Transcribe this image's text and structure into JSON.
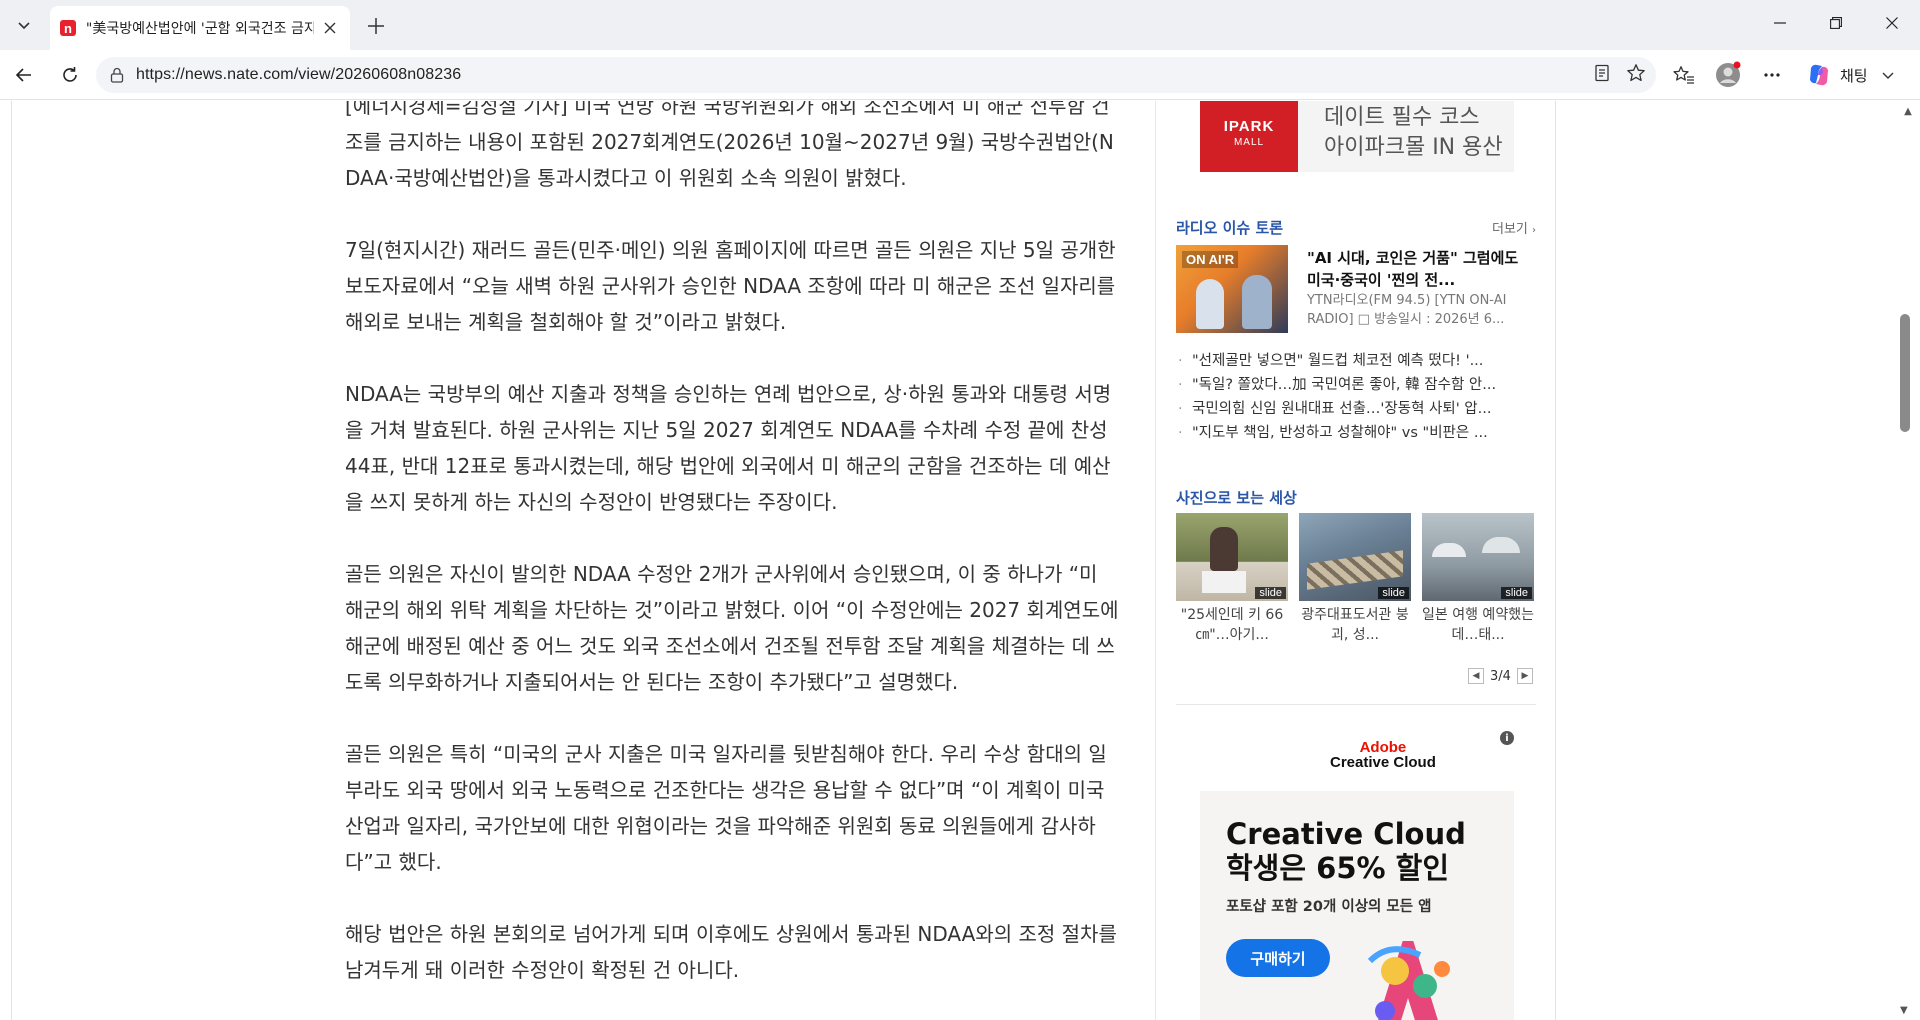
{
  "browser": {
    "tab_title": "\"美국방예산법안에 '군함 외국건조 금지' 조항\"",
    "favicon_letter": "n",
    "url": "https://news.nate.com/view/20260608n08236",
    "chat_label": "채팅",
    "icons": {
      "tab_list": "chevron-down-icon",
      "close_tab": "close-icon",
      "new_tab": "plus-icon",
      "back": "back-arrow-icon",
      "reload": "reload-icon",
      "site_info": "lock-icon",
      "reader": "reader-mode-icon",
      "favorite": "star-icon",
      "favorites_bar": "favorites-icon",
      "profile": "profile-icon",
      "more": "more-icon",
      "copilot": "copilot-icon"
    },
    "accent_color": "#e8212e"
  },
  "article": {
    "paragraphs": [
      "[에너지경제=김성철 기자] 미국 연방 하원 국방위원회가 해외 조선소에서 미 해군 전투함 건조를 금지하는 내용이 포함된 2027회계연도(2026년 10월~2027년 9월) 국방수권법안(NDAA·국방예산법안)을 통과시켰다고 이 위원회 소속 의원이 밝혔다.",
      "7일(현지시간) 재러드 골든(민주·메인) 의원 홈페이지에 따르면 골든 의원은 지난 5일 공개한 보도자료에서 “오늘 새벽 하원 군사위가 승인한 NDAA 조항에 따라 미 해군은 조선 일자리를 해외로 보내는 계획을 철회해야 할 것”이라고 밝혔다.",
      "NDAA는 국방부의 예산 지출과 정책을 승인하는 연례 법안으로, 상·하원 통과와 대통령 서명을 거쳐 발효된다. 하원 군사위는 지난 5일 2027 회계연도 NDAA를 수차례 수정 끝에 찬성 44표, 반대 12표로 통과시켰는데, 해당 법안에 외국에서 미 해군의 군함을 건조하는 데 예산을 쓰지 못하게 하는 자신의 수정안이 반영됐다는 주장이다.",
      "골든 의원은 자신이 발의한 NDAA 수정안 2개가 군사위에서 승인됐으며, 이 중 하나가 “미 해군의 해외 위탁 계획을 차단하는 것”이라고 밝혔다. 이어 “이 수정안에는 2027 회계연도에 해군에 배정된 예산 중 어느 것도 외국 조선소에서 건조될 전투함 조달 계획을 체결하는 데 쓰도록 의무화하거나 지출되어서는 안 된다는 조항이 추가됐다”고 설명했다.",
      "골든 의원은 특히 “미국의 군사 지출은 미국 일자리를 뒷받침해야 한다. 우리 수상 함대의 일부라도 외국 땅에서 외국 노동력으로 건조한다는 생각은 용납할 수 없다”며 “이 계획이 미국 산업과 일자리, 국가안보에 대한 위협이라는 것을 파악해준 위원회 동료 의원들에게 감사하다”고 했다.",
      "해당 법안은 하원 본회의로 넘어가게 되며 이후에도 상원에서 통과된 NDAA와의 조정 절차를 남겨두게 돼 이러한 수정안이 확정된 건 아니다."
    ]
  },
  "sidebar": {
    "ipark_ad": {
      "logo_line1": "IPARK",
      "logo_line2": "MALL",
      "line1": "데이트 필수 코스",
      "line2": "아이파크몰 IN 용산",
      "brand_color": "#d21f26"
    },
    "radio": {
      "section_title": "라디오 이슈 토론",
      "more_label": "더보기",
      "thumb_label": "ON AI'R",
      "headline": "\"AI 시대, 코인은 거품\" 그럼에도 미국·중국이 '찐의 전...",
      "meta": "YTN라디오(FM 94.5) [YTN ON-AI RADIO] □ 방송일시 : 2026년 6..."
    },
    "news_items": [
      "\"선제골만 넣으면\" 월드컵 체코전 예측 떴다! '...",
      "\"독일? 쫄았다…加 국민여론 좋아, 韓 잠수함 안...",
      "국민의힘 신임 원내대표 선출…'장동혁 사퇴' 압...",
      "\"지도부 책임, 반성하고 성찰해야\" vs \"비판은 ..."
    ],
    "photos": {
      "section_title": "사진으로 보는 세상",
      "slide_label": "slide",
      "items": [
        {
          "caption": "\"25세인데 키 66㎝\"…아기..."
        },
        {
          "caption": "광주대표도서관 붕괴, 성..."
        },
        {
          "caption": "일본 여행 예약했는데…태..."
        }
      ],
      "pager": "3/4"
    },
    "adobe_ad": {
      "brand_line1": "Adobe",
      "brand_line2": "Creative Cloud",
      "title_line1": "Creative Cloud",
      "title_line2": "학생은 65% 할인",
      "subtitle": "포토샵 포함 20개 이상의 모든 앱",
      "button": "구매하기",
      "info": "i",
      "brand_color": "#eb1000",
      "button_color": "#1473e6"
    }
  }
}
